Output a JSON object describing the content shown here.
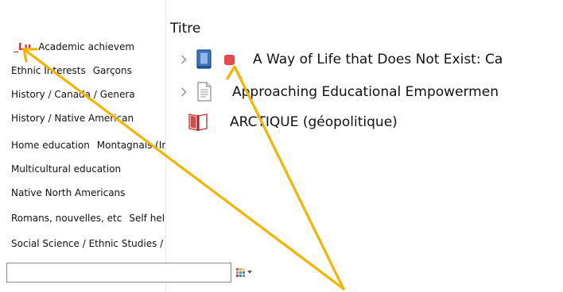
{
  "tag_selector": {
    "rows": [
      {
        "tags": [
          {
            "label": "_Lu",
            "color": "#d9242c"
          },
          {
            "label": "Academic achievem"
          }
        ]
      },
      {
        "tags": [
          {
            "label": "Ethnic Interests"
          },
          {
            "label": "Garçons"
          }
        ]
      },
      {
        "tags": [
          {
            "label": "History / Canada / Genera"
          }
        ]
      },
      {
        "tags": [
          {
            "label": "History / Native American"
          }
        ]
      },
      {
        "tags": [
          {
            "label": "Home education"
          },
          {
            "label": "Montagnais (Indiens)"
          }
        ]
      },
      {
        "tags": [
          {
            "label": "Multicultural education"
          }
        ]
      },
      {
        "tags": [
          {
            "label": "Native North Americans"
          }
        ]
      },
      {
        "tags": [
          {
            "label": "Romans, nouvelles, etc"
          },
          {
            "label": "Self help"
          }
        ]
      },
      {
        "tags": [
          {
            "label": "Social Science / Ethnic Studies / Native ..."
          }
        ]
      }
    ],
    "search": {
      "value": "",
      "placeholder": ""
    },
    "actions_icon": "colored-grid-dropdown-icon"
  },
  "items_tree": {
    "column_header": "Titre",
    "rows": [
      {
        "title": "A Way of Life that Does Not Exist: Ca",
        "icon": "book-icon",
        "expandable": true,
        "tag_color": "#e5484d"
      },
      {
        "title": "Approaching Educational Empowermen",
        "icon": "document-icon",
        "expandable": true
      },
      {
        "title": "ARCTIQUE (géopolitique)",
        "icon": "book-section-icon",
        "expandable": false
      }
    ]
  },
  "annotations": {
    "arrow_color": "#f5b400"
  },
  "colors": {
    "grid_dots": [
      "#e5484d",
      "#f5a623",
      "#f8d347",
      "#5cb85c",
      "#4a90e2",
      "#9b59b6",
      "#e91e63",
      "#16a085",
      "#7f8c8d"
    ],
    "icon_book_blue": "#3b78c2",
    "icon_book_red": "#d24b4b"
  }
}
